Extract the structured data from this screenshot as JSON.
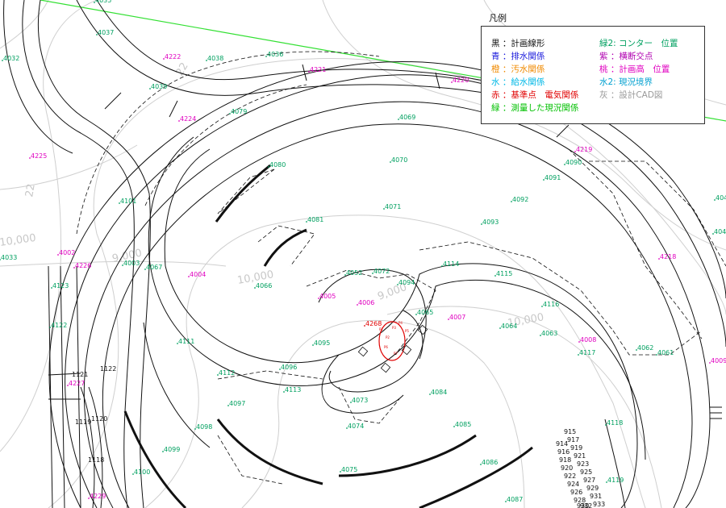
{
  "legend": {
    "title": "凡例",
    "entries": [
      {
        "text": "黒 ：計画線形",
        "color": "#111111"
      },
      {
        "text": "青 ：排水関係",
        "color": "#1a1adc"
      },
      {
        "text": "橙 ：汚水関係",
        "color": "#f08a00"
      },
      {
        "text": "水 ：給水関係",
        "color": "#00b8e6"
      },
      {
        "text": "赤 ：基準点　電気関係",
        "color": "#e00000"
      },
      {
        "text": "緑 ：測量した現況関係",
        "color": "#00c000"
      },
      {
        "text": "緑2: コンター　位置",
        "color": "#00a060"
      },
      {
        "text": "紫 ：横断交点",
        "color": "#b000b0"
      },
      {
        "text": "桃 ：計画高　位置",
        "color": "#e000c0"
      },
      {
        "text": "水2: 現況境界",
        "color": "#00a0d0"
      },
      {
        "text": "灰 ：設計CAD図",
        "color": "#999999"
      }
    ]
  },
  "colors": {
    "plan_line": "#111111",
    "survey_green": "#33e033",
    "contour_gray": "#c8c8c8",
    "point_green": "#00a060",
    "point_magenta": "#e000c0",
    "benchmark_red": "#e00000"
  },
  "contour_labels": [
    "10,000",
    "9,000",
    "10,000",
    "9,000",
    "10,000",
    "22",
    "22"
  ],
  "survey_points": [
    "4035",
    "4037",
    "4036",
    "4038",
    "4032",
    "4039",
    "4069",
    "4079",
    "4070",
    "4071",
    "4081",
    "4080",
    "4091",
    "4092",
    "4093",
    "4090",
    "4101",
    "4033",
    "4003",
    "4067",
    "4066",
    "4065",
    "4114",
    "4115",
    "4116",
    "4064",
    "4063",
    "4062",
    "4061",
    "4123",
    "4122",
    "4111",
    "4112",
    "4113",
    "4096",
    "4095",
    "4094",
    "4072",
    "4073",
    "4074",
    "4075",
    "4084",
    "4085",
    "4086",
    "4087",
    "4097",
    "4098",
    "4099",
    "4100",
    "4117",
    "4118",
    "4119",
    "4045",
    "4046",
    "4052"
  ],
  "section_points": [
    "4222",
    "4221",
    "4220",
    "4224",
    "4225",
    "4219",
    "4218",
    "4004",
    "4002",
    "4226",
    "4005",
    "4006",
    "4007",
    "4008",
    "4009",
    "4227",
    "4229"
  ],
  "benchmark_points": [
    "4268"
  ],
  "black_points": [
    "1121",
    "1122",
    "1119",
    "1120",
    "1118",
    "915",
    "917",
    "919",
    "921",
    "923",
    "925",
    "927",
    "929",
    "931",
    "933",
    "914",
    "916",
    "918",
    "920",
    "922",
    "924",
    "926",
    "928",
    "930",
    "932"
  ],
  "red_small_labels": [
    "P1",
    "P2",
    "P3",
    "P4",
    "P5",
    "P6",
    "P7"
  ]
}
